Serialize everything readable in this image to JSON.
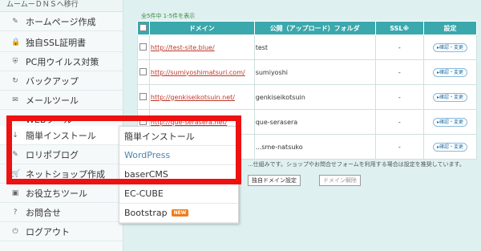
{
  "sidebar": {
    "top_text": "ムームーＤＮＳへ移行",
    "items": [
      {
        "label": "ホームページ作成",
        "icon": "edit-icon",
        "glyph": "✎"
      },
      {
        "label": "独自SSL証明書",
        "icon": "lock-icon",
        "glyph": "🔒"
      },
      {
        "label": "PC用ウイルス対策",
        "icon": "shield-icon",
        "glyph": "⛨"
      },
      {
        "label": "バックアップ",
        "icon": "refresh-icon",
        "glyph": "↻"
      },
      {
        "label": "メールツール",
        "icon": "mail-icon",
        "glyph": "✉"
      },
      {
        "label": "WEBツール",
        "icon": "monitor-icon",
        "glyph": "▭"
      },
      {
        "label": "簡単インストール",
        "icon": "download-icon",
        "glyph": "↓"
      },
      {
        "label": "ロリポブログ",
        "icon": "pencil-icon",
        "glyph": "✎"
      },
      {
        "label": "ネットショップ作成",
        "icon": "cart-icon",
        "glyph": "🛒"
      },
      {
        "label": "お役立ちツール",
        "icon": "briefcase-icon",
        "glyph": "▣"
      },
      {
        "label": "お問合せ",
        "icon": "question-icon",
        "glyph": "?"
      },
      {
        "label": "ログアウト",
        "icon": "power-icon",
        "glyph": "⏻"
      }
    ]
  },
  "main": {
    "count_text": "全5件中 1-5件を表示",
    "columns": [
      "ドメイン",
      "公開（アップロード）フォルダ",
      "SSL※",
      "設定"
    ],
    "rows": [
      {
        "domain": "http://test-site.blue/",
        "folder": "test",
        "ssl": "-",
        "action": "確認・変更"
      },
      {
        "domain": "http://sumiyoshimatsuri.com/",
        "folder": "sumiyoshi",
        "ssl": "-",
        "action": "確認・変更"
      },
      {
        "domain": "http://genkiseikotsuin.net/",
        "folder": "genkiseikotsuin",
        "ssl": "-",
        "action": "確認・変更"
      },
      {
        "domain": "http://que-serasera.net/",
        "folder": "que-serasera",
        "ssl": "-",
        "action": "確認・変更"
      },
      {
        "domain": "http://...natsuko.com/",
        "folder": "...sme-natsuko",
        "ssl": "-",
        "action": "確認・変更"
      }
    ],
    "note": "...仕組みです。ショップやお問合せフォームを利用する場合は設定を推奨しています。",
    "btn_domain_setting": "独自ドメイン設定",
    "btn_domain_remove": "ドメイン解除"
  },
  "dropdown": {
    "items": [
      "簡単インストール",
      "WordPress",
      "baserCMS",
      "EC-CUBE",
      "Bootstrap"
    ],
    "new_badge": "NEW"
  }
}
